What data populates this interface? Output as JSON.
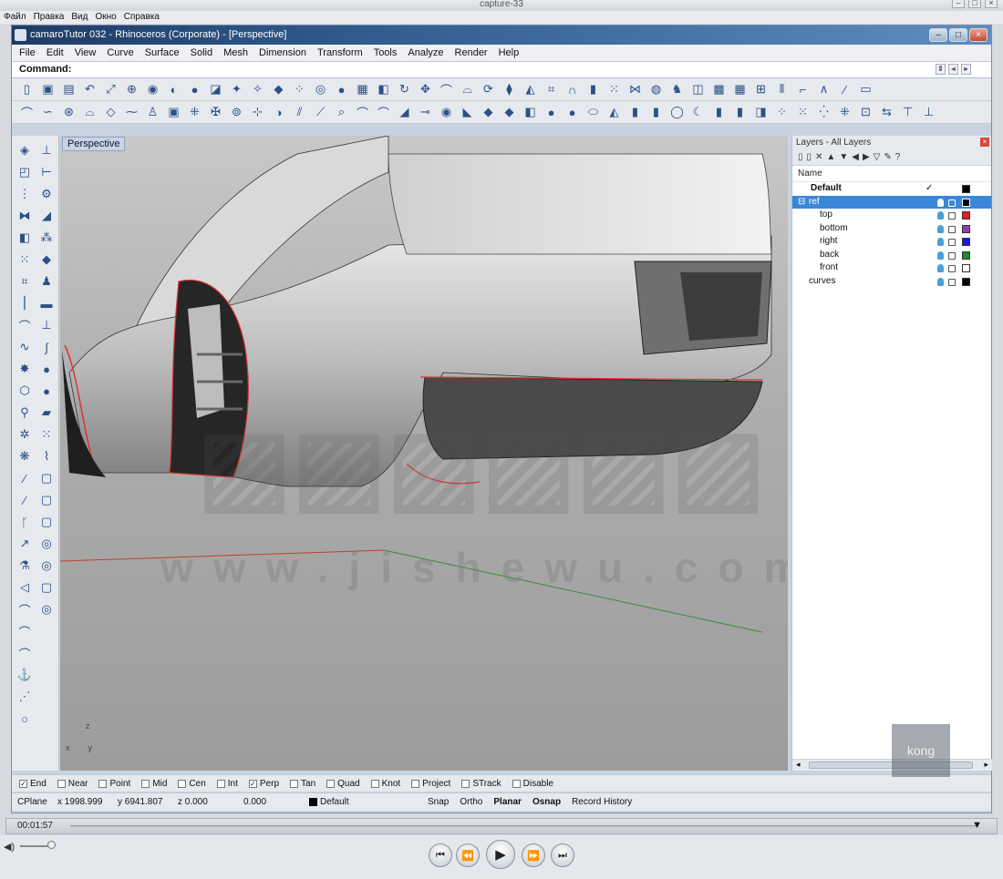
{
  "capture": {
    "title": "capture-33",
    "menu": [
      "Файл",
      "Правка",
      "Вид",
      "Окно",
      "Справка"
    ]
  },
  "window": {
    "title": "camaroTutor 032 - Rhinoceros (Corporate) - [Perspective]",
    "menu": [
      "File",
      "Edit",
      "View",
      "Curve",
      "Surface",
      "Solid",
      "Mesh",
      "Dimension",
      "Transform",
      "Tools",
      "Analyze",
      "Render",
      "Help"
    ],
    "command_label": "Command:"
  },
  "viewport": {
    "label": "Perspective",
    "axis_z": "z",
    "axis_x": "x",
    "axis_y": "y"
  },
  "layers": {
    "title": "Layers - All Layers",
    "column_name": "Name",
    "items": [
      {
        "name": "Default",
        "bold": true,
        "current": "✓",
        "color": "#000000"
      },
      {
        "name": "ref",
        "selected": true,
        "color": "#000000"
      },
      {
        "name": "top",
        "color": "#e02020"
      },
      {
        "name": "bottom",
        "color": "#8a3fb8"
      },
      {
        "name": "right",
        "color": "#1a1ae0"
      },
      {
        "name": "back",
        "color": "#1a8a2a"
      },
      {
        "name": "front",
        "color": "#ffffff"
      },
      {
        "name": "curves",
        "color": "#000000"
      }
    ]
  },
  "osnap": [
    {
      "label": "End",
      "checked": true
    },
    {
      "label": "Near",
      "checked": false
    },
    {
      "label": "Point",
      "checked": false
    },
    {
      "label": "Mid",
      "checked": false
    },
    {
      "label": "Cen",
      "checked": false
    },
    {
      "label": "Int",
      "checked": false
    },
    {
      "label": "Perp",
      "checked": true
    },
    {
      "label": "Tan",
      "checked": false
    },
    {
      "label": "Quad",
      "checked": false
    },
    {
      "label": "Knot",
      "checked": false
    },
    {
      "label": "Project",
      "checked": false
    },
    {
      "label": "STrack",
      "checked": false
    },
    {
      "label": "Disable",
      "checked": false
    }
  ],
  "status": {
    "cplane": "CPlane",
    "x": "x 1998.999",
    "y": "y 6941.807",
    "z": "z 0.000",
    "dist": "0.000",
    "layer": "Default",
    "snap": "Snap",
    "ortho": "Ortho",
    "planar": "Planar",
    "osnap": "Osnap",
    "history": "Record History"
  },
  "player": {
    "time": "00:01:57"
  },
  "watermark": {
    "logo": "kong"
  }
}
